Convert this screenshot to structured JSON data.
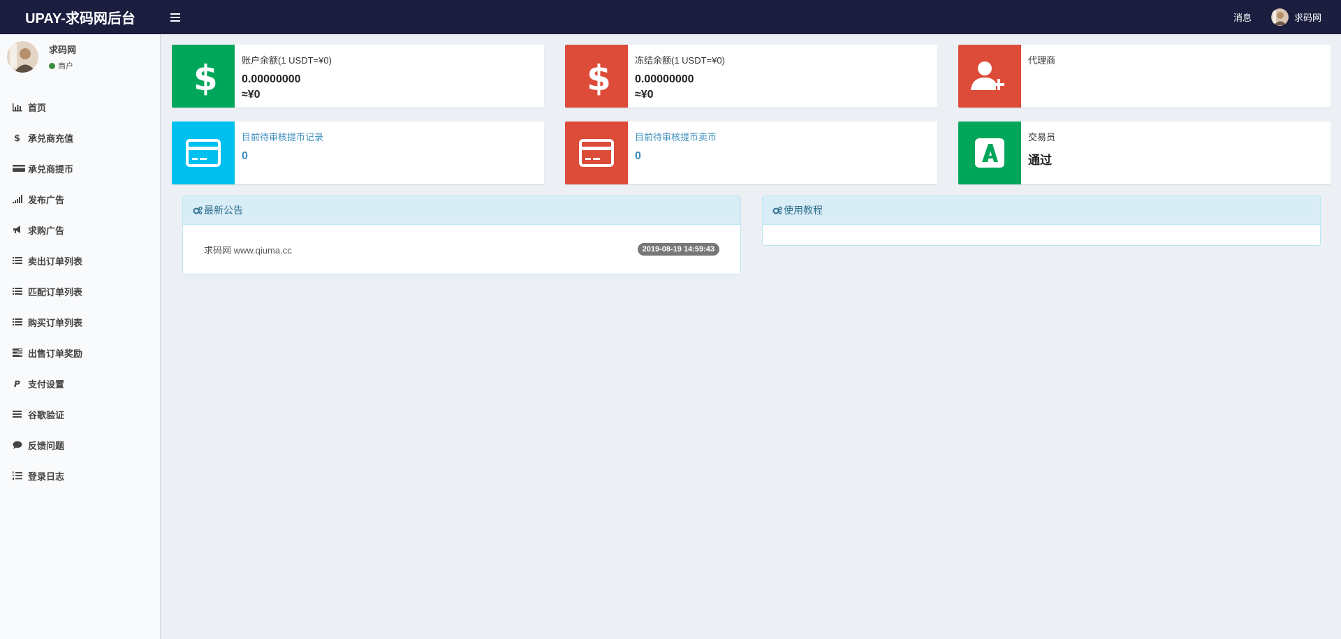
{
  "header": {
    "logo": "UPAY-求码网后台",
    "messages_label": "消息",
    "user_name": "求码网"
  },
  "sidebar": {
    "user_name": "求码网",
    "user_role": "商户",
    "items": [
      {
        "label": "首页",
        "icon": "bar-chart-icon"
      },
      {
        "label": "承兑商充值",
        "icon": "dollar-icon"
      },
      {
        "label": "承兑商提币",
        "icon": "credit-card-icon"
      },
      {
        "label": "发布广告",
        "icon": "signal-icon"
      },
      {
        "label": "求购广告",
        "icon": "bullhorn-icon"
      },
      {
        "label": "卖出订单列表",
        "icon": "list-icon"
      },
      {
        "label": "匹配订单列表",
        "icon": "list-icon"
      },
      {
        "label": "购买订单列表",
        "icon": "list-icon"
      },
      {
        "label": "出售订单奖励",
        "icon": "tasks-icon"
      },
      {
        "label": "支付设置",
        "icon": "paypal-icon"
      },
      {
        "label": "谷歌验证",
        "icon": "bars-icon"
      },
      {
        "label": "反馈问题",
        "icon": "comment-icon"
      },
      {
        "label": "登录日志",
        "icon": "list-ol-icon"
      }
    ]
  },
  "boxes": {
    "balance": {
      "label": "账户余额(1 USDT=¥0)",
      "value": "0.00000000",
      "sub": "≈¥0"
    },
    "frozen": {
      "label": "冻结余额(1 USDT=¥0)",
      "value": "0.00000000",
      "sub": "≈¥0"
    },
    "agent": {
      "label": "代理商"
    },
    "withdraw_pending": {
      "label": "目前待审核提币记录",
      "value": "0"
    },
    "sell_pending": {
      "label": "目前待审核提币卖币",
      "value": "0"
    },
    "trader": {
      "label": "交易员",
      "value": "通过"
    }
  },
  "panels": {
    "notice": {
      "title": "最新公告",
      "items": [
        {
          "text": "求码网 www.qiuma.cc",
          "date": "2019-08-19 14:59:43"
        }
      ]
    },
    "tutorial": {
      "title": "使用教程"
    }
  },
  "colors": {
    "green": "#00a65a",
    "red": "#dd4b39",
    "aqua": "#00c0ef",
    "header": "#1b1e3f"
  }
}
